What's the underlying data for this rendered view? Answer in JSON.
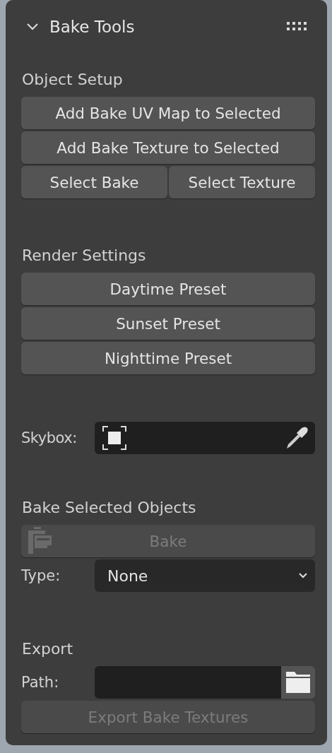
{
  "panel": {
    "title": "Bake Tools",
    "expanded": true
  },
  "sections": [
    {
      "heading": "Object Setup",
      "items": [
        {
          "kind": "button",
          "label": "Add Bake UV Map to Selected",
          "disabled": false
        },
        {
          "kind": "button",
          "label": "Add Bake Texture to Selected",
          "disabled": false
        },
        {
          "kind": "button_pair",
          "buttons": [
            {
              "label": "Select Bake",
              "disabled": false
            },
            {
              "label": "Select Texture",
              "disabled": false
            }
          ]
        }
      ]
    },
    {
      "heading": "Render Settings",
      "items": [
        {
          "kind": "button",
          "label": "Daytime Preset",
          "disabled": false
        },
        {
          "kind": "button",
          "label": "Sunset Preset",
          "disabled": false
        },
        {
          "kind": "button",
          "label": "Nighttime Preset",
          "disabled": false
        }
      ]
    },
    {
      "items": [
        {
          "kind": "color_field",
          "label": "Skybox:"
        }
      ]
    },
    {
      "heading": "Bake Selected Objects",
      "items": [
        {
          "kind": "icon_button",
          "label": "Bake",
          "disabled": true
        },
        {
          "kind": "dropdown",
          "label": "Type:",
          "value": "None"
        }
      ]
    },
    {
      "heading": "Export",
      "items": [
        {
          "kind": "path_field",
          "label": "Path:"
        },
        {
          "kind": "button",
          "label": "Export Bake Textures",
          "disabled": true
        }
      ]
    }
  ]
}
